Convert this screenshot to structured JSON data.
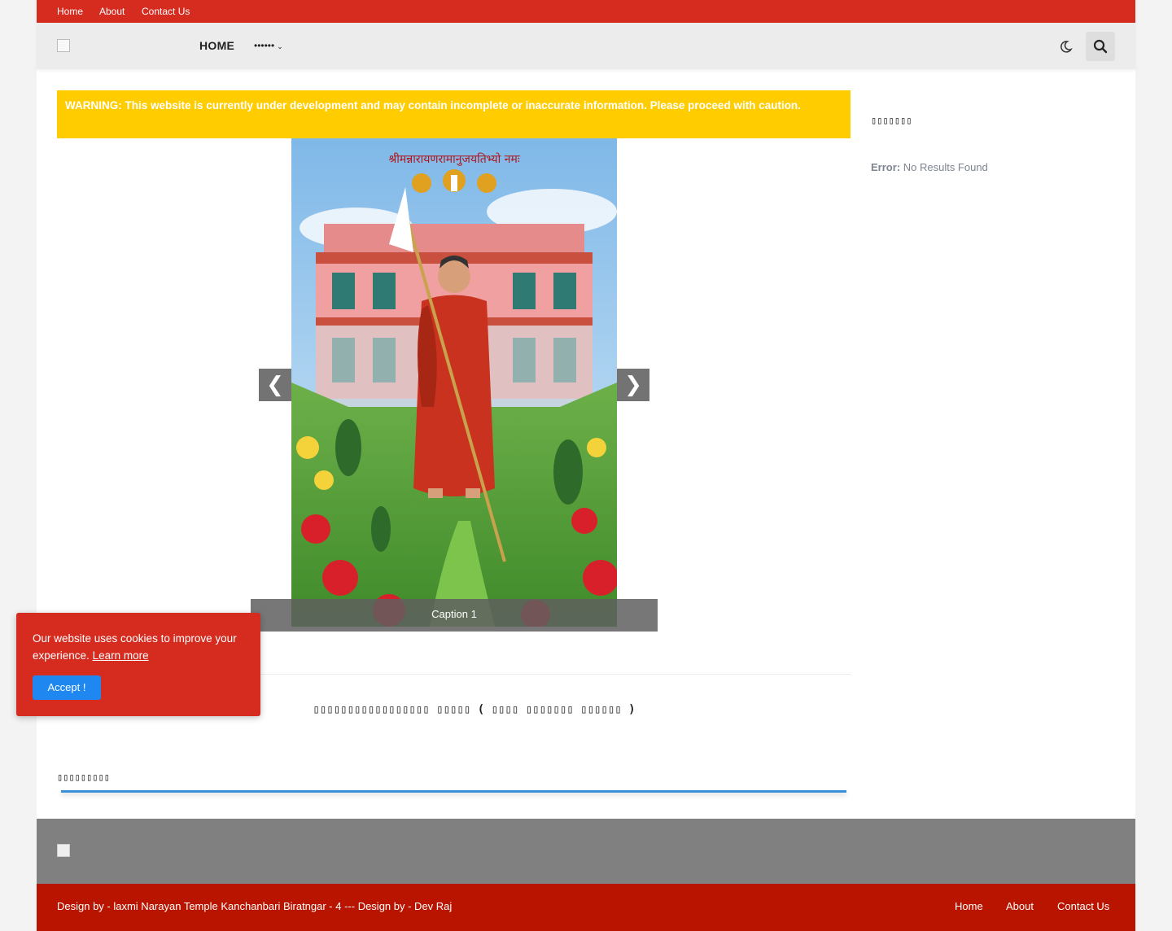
{
  "topbar": {
    "links": [
      "Home",
      "About",
      "Contact Us"
    ]
  },
  "header": {
    "nav_home": "HOME",
    "nav_menu": "••••••",
    "chevron": "‹"
  },
  "warning": {
    "text": "WARNING: This website is currently under development and may contain incomplete or inaccurate information. Please proceed with caution."
  },
  "slider": {
    "prev": "❮",
    "next": "❯",
    "caption": "Caption 1",
    "banner_text": "श्रीमन्नारायणरामानुजयतिभ्यो नमः"
  },
  "post": {
    "title": "▯▯▯▯▯▯▯▯▯▯▯▯▯▯▯▯▯ ▯▯▯▯▯ ( ▯▯▯▯ ▯▯▯▯▯▯▯ ▯▯▯▯▯▯ )"
  },
  "section": {
    "title": "▯▯▯▯▯▯▯▯▯"
  },
  "sidebar": {
    "title": "▯▯▯▯▯▯▯",
    "error_label": "Error:",
    "error_text": " No Results Found"
  },
  "footer": {
    "credit": "Design by - laxmi Narayan Temple Kanchanbari Biratngar - 4 --- Design by - Dev Raj",
    "links": [
      "Home",
      "About",
      "Contact Us"
    ]
  },
  "cookie": {
    "text": "Our website uses cookies to improve your experience.",
    "learn_more": "Learn more",
    "accept": "Accept !"
  },
  "colors": {
    "topbar": "#d62b1f",
    "warning": "#ffcc00",
    "footer_bottom": "#b81400",
    "accent": "#1e88f0"
  }
}
